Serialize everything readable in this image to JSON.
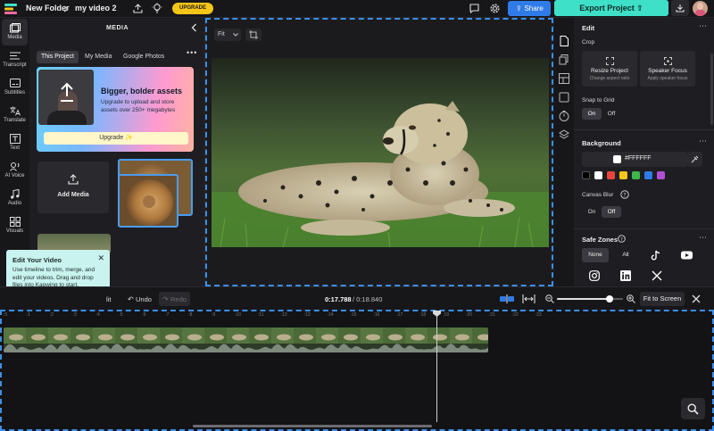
{
  "app": {
    "folder": "New Folder",
    "project": "my video 2",
    "upgrade_label": "UPGRADE",
    "share_label": "Share",
    "export_label": "Export Project"
  },
  "rail": [
    {
      "label": "Media",
      "icon": "media-icon"
    },
    {
      "label": "Transcript",
      "icon": "transcript-icon"
    },
    {
      "label": "Subtitles",
      "icon": "subtitles-icon"
    },
    {
      "label": "Translate",
      "icon": "translate-icon"
    },
    {
      "label": "Text",
      "icon": "text-icon"
    },
    {
      "label": "AI Voice",
      "icon": "ai-voice-icon"
    },
    {
      "label": "Audio",
      "icon": "audio-icon"
    },
    {
      "label": "Visuals",
      "icon": "visuals-icon"
    }
  ],
  "media": {
    "title": "MEDIA",
    "tabs": [
      "This Project",
      "My Media",
      "Google Photos"
    ],
    "promo_head": "Bigger, bolder assets",
    "promo_body": "Upgrade to upload and store assets over 250+ megabytes",
    "promo_btn": "Upgrade ✨",
    "add_media": "Add Media"
  },
  "tooltip": {
    "head": "Edit Your Video",
    "body": "Use timeline to trim, merge, and edit your videos. Drag and drop files into Kapwing to start."
  },
  "canvas": {
    "fit_label": "Fit"
  },
  "props": {
    "edit": "Edit",
    "crop": "Crop",
    "resize_title": "Resize Project",
    "resize_sub": "Change aspect ratio",
    "speaker_title": "Speaker Focus",
    "speaker_sub": "Apply speaker focus",
    "snap": "Snap to Grid",
    "on": "On",
    "off": "Off",
    "background": "Background",
    "bg_hex": "#FFFFFF",
    "canvas_blur": "Canvas Blur",
    "safe_zones": "Safe Zones",
    "none": "None",
    "all": "All",
    "swatches": [
      "#000000",
      "#ffffff",
      "#e8453c",
      "#f5c518",
      "#3db84a",
      "#2f7be8",
      "#b24fd6"
    ]
  },
  "toolbar": {
    "split": "lit",
    "undo": "Undo",
    "redo": "Redo",
    "current_time": "0:17.788",
    "total_time": "/ 0:18.840",
    "fit_screen": "Fit to Screen"
  },
  "timeline": {
    "ticks": [
      ":0",
      ":1",
      ":2",
      ":3",
      ":4",
      ":5",
      ":6",
      ":7",
      ":8",
      ":9",
      ":10",
      ":11",
      ":12",
      ":13",
      ":14",
      ":15",
      ":16",
      ":17",
      ":18",
      ":19",
      ":20",
      ":21",
      ":22",
      ":23"
    ],
    "zoom_level": 0.8
  }
}
